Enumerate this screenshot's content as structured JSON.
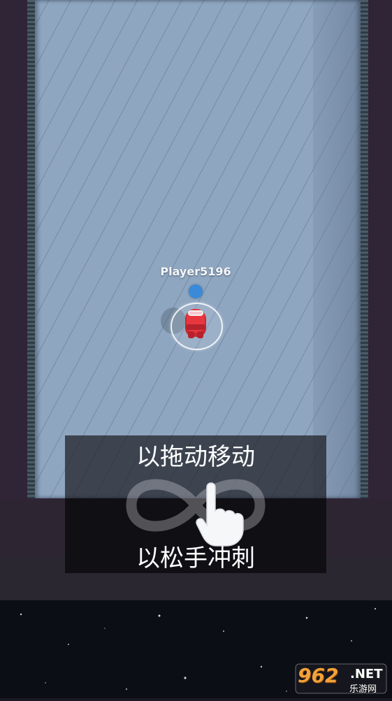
{
  "player": {
    "name": "Player5196",
    "color": "#e8363f",
    "indicator_color": "#3b8ad9"
  },
  "tutorial": {
    "drag_text": "以拖动移动",
    "release_text": "以松手冲刺"
  },
  "watermark": {
    "number": "962",
    "suffix": ".NET",
    "site_name": "乐游网"
  },
  "icons": [
    "infinity-gesture-icon",
    "hand-pointer-icon"
  ]
}
